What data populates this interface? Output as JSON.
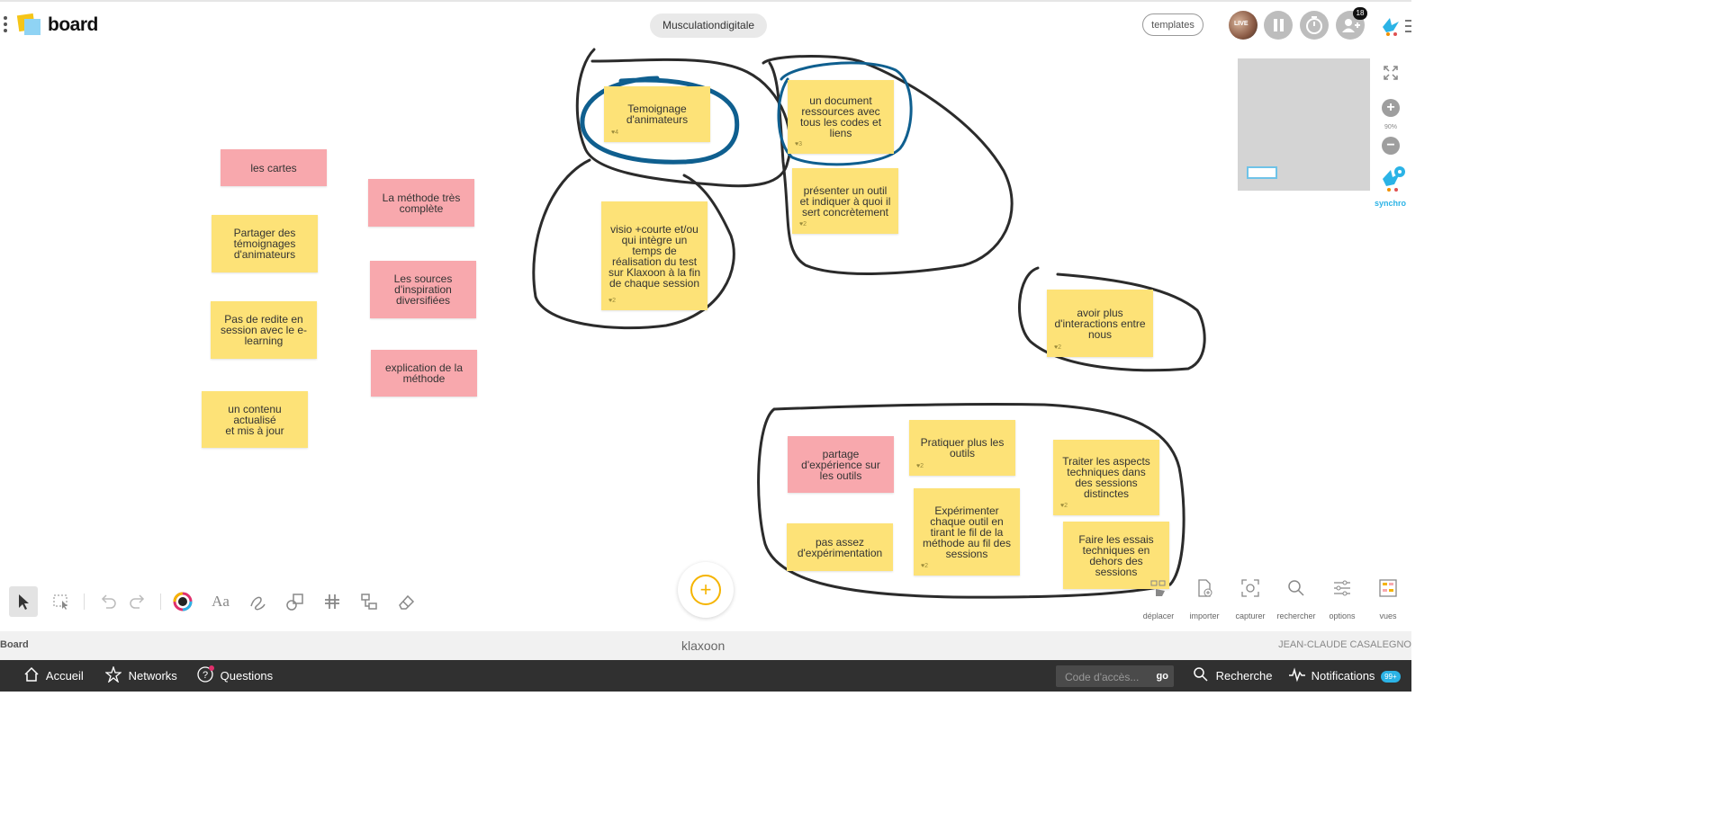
{
  "header": {
    "brand": "board",
    "board_title": "Musculationdigitale",
    "templates_label": "templates",
    "live_label": "LIVE",
    "participants_count": "18"
  },
  "notes": [
    {
      "text": "les cartes",
      "color": "pink",
      "likes": ""
    },
    {
      "text": "La méthode très complète",
      "color": "pink",
      "likes": ""
    },
    {
      "text": "Partager des témoignages d'animateurs",
      "color": "yellow",
      "likes": ""
    },
    {
      "text": "Les sources d'inspiration diversifiées",
      "color": "pink",
      "likes": ""
    },
    {
      "text": "Pas de redite en session avec le e-learning",
      "color": "yellow",
      "likes": ""
    },
    {
      "text": "explication de la méthode",
      "color": "pink",
      "likes": ""
    },
    {
      "text": "un contenu actualisé\net mis à jour",
      "color": "yellow",
      "likes": ""
    },
    {
      "text": "Temoignage d'animateurs",
      "color": "yellow",
      "likes": "♥4"
    },
    {
      "text": "visio +courte et/ou qui intègre un temps de réalisation du test sur Klaxoon à la fin de chaque session",
      "color": "yellow",
      "likes": "♥2"
    },
    {
      "text": "un document ressources avec tous les codes et liens",
      "color": "yellow",
      "likes": "♥3"
    },
    {
      "text": "présenter un outil et indiquer à quoi il sert concrètement",
      "color": "yellow",
      "likes": "♥2"
    },
    {
      "text": "avoir plus d'interactions entre nous",
      "color": "yellow",
      "likes": "♥2"
    },
    {
      "text": "partage d'expérience sur les outils",
      "color": "pink",
      "likes": ""
    },
    {
      "text": "Pratiquer plus les outils",
      "color": "yellow",
      "likes": "♥2"
    },
    {
      "text": "Traiter les aspects techniques dans des sessions distinctes",
      "color": "yellow",
      "likes": "♥2"
    },
    {
      "text": "pas assez d'expérimentation",
      "color": "yellow",
      "likes": ""
    },
    {
      "text": "Expérimenter chaque outil en tirant le fil de la méthode au fil des sessions",
      "color": "yellow",
      "likes": "♥2"
    },
    {
      "text": "Faire les essais techniques en dehors des sessions",
      "color": "yellow",
      "likes": ""
    }
  ],
  "side_panel": {
    "zoom_level": "90%",
    "synchro_label": "synchro"
  },
  "bottom_tools": {
    "deplacer": "déplacer",
    "importer": "importer",
    "capturer": "capturer",
    "rechercher": "rechercher",
    "options": "options",
    "vues": "vues"
  },
  "statusbar": {
    "left": "Board",
    "center": "klaxoon",
    "right": "JEAN-CLAUDE CASALEGNO"
  },
  "footer": {
    "accueil": "Accueil",
    "networks": "Networks",
    "questions": "Questions",
    "access_placeholder": "Code d'accès...",
    "go": "go",
    "recherche": "Recherche",
    "notifications": "Notifications",
    "notif_count": "99+"
  },
  "colors": {
    "pink_note": "#f8a8ad",
    "yellow_note": "#fde277",
    "ink_black": "#2b2b2b",
    "ink_blue": "#0f5f8f",
    "accent": "#2bb3e6"
  }
}
